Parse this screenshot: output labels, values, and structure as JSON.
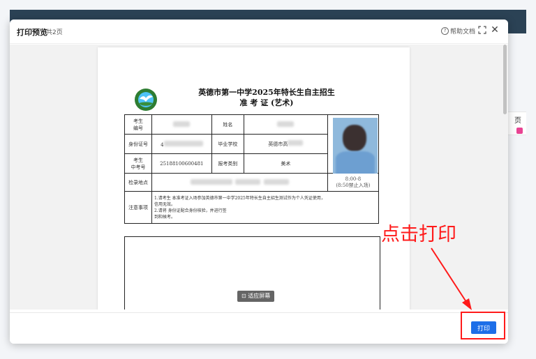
{
  "dialog": {
    "title": "打印预览",
    "page_count": "共2页",
    "help_label": "帮助文档",
    "print_label": "打印",
    "fit_screen_label": "适应屏幕"
  },
  "document": {
    "title_line1": "英德市第一中学2025年特长生自主招生",
    "title_line2": "准 考 证 (艺术)",
    "labels": {
      "examinee_no": "考生\n编号",
      "name": "姓名",
      "id_no": "身份证号",
      "graduate_school": "毕业学校",
      "exam_no": "考生\n中考号",
      "category": "报考类别",
      "checkin_place": "检录地点",
      "notes": "注意事项"
    },
    "values": {
      "id_prefix": "4",
      "school_prefix": "英德市高",
      "exam_no": "25188100600481",
      "category": "美术",
      "time": "8:00-8\n(8:50禁止入场)"
    },
    "notes_text": {
      "line1": "1.请考生 本准考证入场参加英德市第一中学2025年特长生自主招生测试作为个人凭证使用，",
      "line1b": "信用无效。",
      "line2": "2.请将 身份证配合身份核验，并进行签",
      "line2b": "到和候考。"
    }
  },
  "annotation": {
    "text": "点击打印",
    "color": "#ff1a1a"
  },
  "colors": {
    "primary": "#1d6ee8",
    "topbar": "#2b4255"
  }
}
